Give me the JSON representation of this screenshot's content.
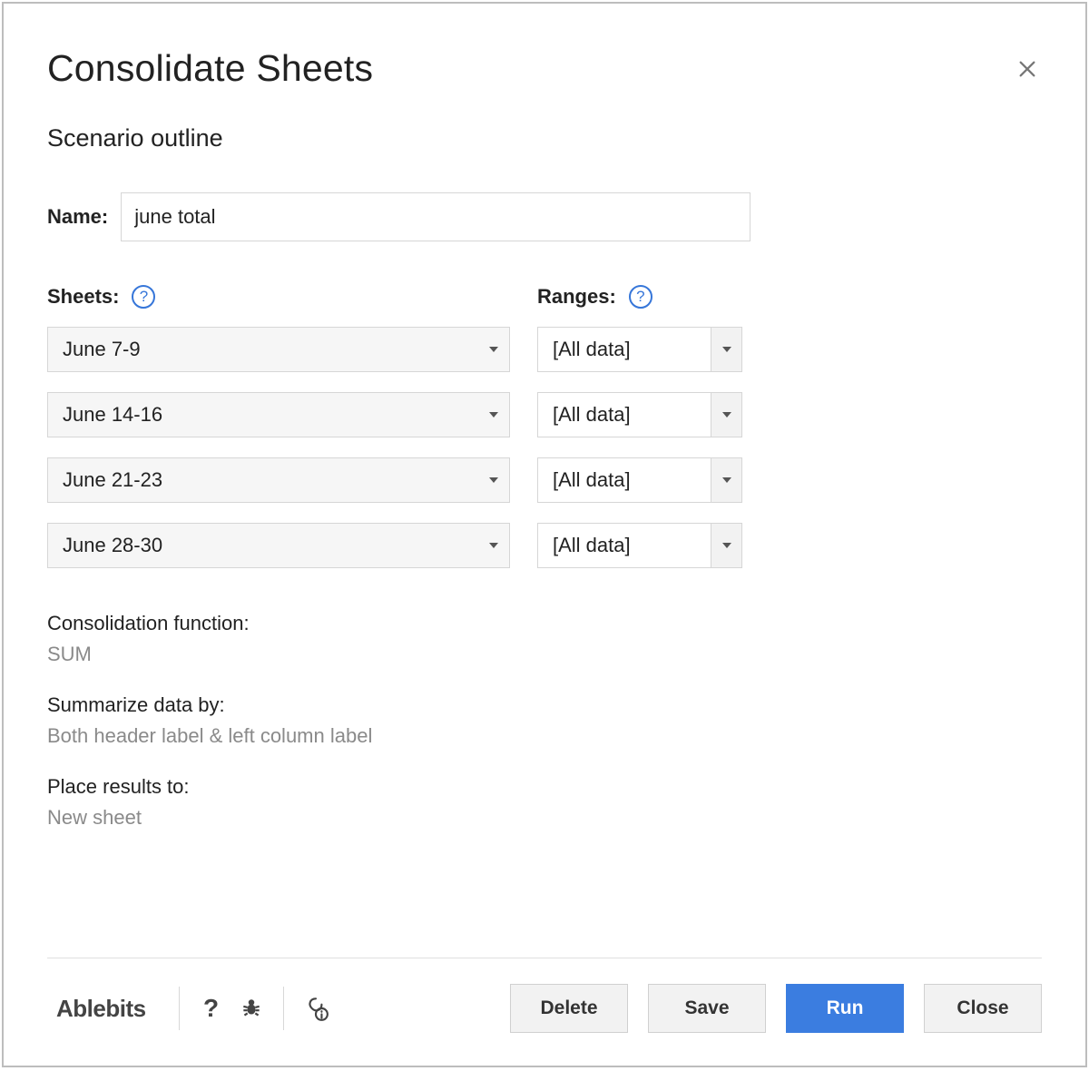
{
  "title": "Consolidate Sheets",
  "subtitle": "Scenario outline",
  "name_label": "Name:",
  "name_value": "june total",
  "sheets_label": "Sheets:",
  "ranges_label": "Ranges:",
  "rows": [
    {
      "sheet": "June 7-9",
      "range": "[All data]"
    },
    {
      "sheet": "June 14-16",
      "range": "[All data]"
    },
    {
      "sheet": "June 21-23",
      "range": "[All data]"
    },
    {
      "sheet": "June 28-30",
      "range": "[All data]"
    }
  ],
  "consolidation_label": "Consolidation function:",
  "consolidation_value": "SUM",
  "summarize_label": "Summarize data by:",
  "summarize_value": "Both header label & left column label",
  "results_label": "Place results to:",
  "results_value": "New sheet",
  "brand": "Ablebits",
  "buttons": {
    "delete": "Delete",
    "save": "Save",
    "run": "Run",
    "close": "Close"
  }
}
